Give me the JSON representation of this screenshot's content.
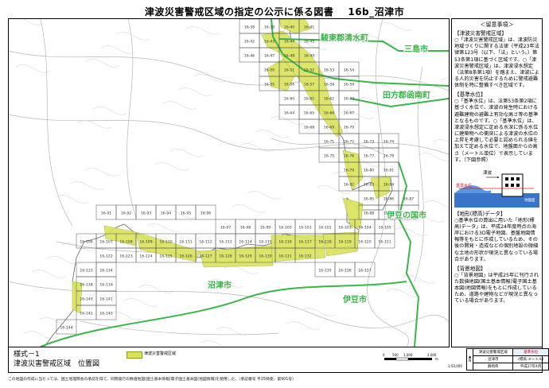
{
  "header": {
    "title": "津波災害警戒区域の指定の公示に係る図書",
    "code": "16b_沼津市"
  },
  "map": {
    "place_labels": [
      {
        "id": "sunto-shimizu",
        "text": "駿東郡清水町"
      },
      {
        "id": "mishima",
        "text": "三島市"
      },
      {
        "id": "tagata-kannami",
        "text": "田方郡函南町"
      },
      {
        "id": "izunokuni",
        "text": "伊豆の国市"
      },
      {
        "id": "numazu",
        "text": "沼津市"
      },
      {
        "id": "izu",
        "text": "伊豆市"
      }
    ],
    "sheets": [
      "16-38",
      "16-39",
      "16-40",
      "16-41",
      "16-42",
      "16-43",
      "16-44",
      "16-45",
      "16-46",
      "16-47",
      "16-48",
      "16-49",
      "16-50",
      "16-51",
      "16-52",
      "16-53",
      "16-54",
      "16-55",
      "16-56",
      "16-57",
      "16-58",
      "16-59",
      "16-60",
      "16-61",
      "16-62",
      "16-63",
      "16-64",
      "16-65",
      "16-66",
      "16-67",
      "16-68",
      "16-69",
      "16-70",
      "16-71",
      "16-72",
      "16-73",
      "16-74",
      "16-75",
      "16-76",
      "16-77",
      "16-78",
      "16-79",
      "16-80",
      "16-81",
      "16-82",
      "16-83",
      "16-84",
      "16-85",
      "16-86",
      "16-87",
      "16-88",
      "16-89",
      "16-90",
      "16-91",
      "16-92",
      "16-93",
      "16-94",
      "16-95",
      "16-96",
      "16-97",
      "16-98",
      "16-99",
      "16-100",
      "16-101",
      "16-102",
      "16-103",
      "16-104",
      "16-105",
      "16-106",
      "16-107",
      "16-108",
      "16-109",
      "16-110",
      "16-111",
      "16-112",
      "16-113",
      "16-114",
      "16-115",
      "16-116",
      "16-117",
      "16-118",
      "16-119",
      "16-120",
      "16-121",
      "16-122",
      "16-123",
      "16-124",
      "16-125",
      "16-126",
      "16-127",
      "16-128",
      "16-129",
      "16-130",
      "16-131",
      "16-132",
      "16-133",
      "16-134",
      "16-135",
      "16-136",
      "16-137",
      "16-138",
      "16-139",
      "16-140",
      "16-141",
      "16-142",
      "16-143",
      "16-144"
    ],
    "colors": {
      "zone": "#d9e35a",
      "zone_edge": "#9aa82a",
      "boundary": "#39b54a",
      "grid": "#555555",
      "road": "#b8b8b8",
      "place_text": "#39b54a"
    }
  },
  "side": {
    "header": "＜留意事項＞",
    "sections": [
      {
        "title": "【津波災害警戒区域】",
        "body": "○「津波災害警戒区域」は、津波防災地域づくりに関する法律（平成23年法律第123号（以下、「法」という。）第53条第1項に基づく区域です。○「津波災害警戒区域」は、津波浸水想定（法第8条第1項）を踏まえ、津波による人的災害を防止するために警戒避難体制を特に整備すべき区域です。"
      },
      {
        "title": "【基準水位】",
        "body": "○「基準水位」は、法第53条第2項に基づく水位で、津波の発生時における避難建物の避難上有効な高さ等の基準となるものです。○「基準水位」は、津波浸水想定に定める水深に係る水位に建築物への衝突による津波の水位の上昇を考慮して必要と認められる値を加えて定める水位で、地盤面からの高さ（メートル単位）で表示しています。（下図参照）"
      },
      {
        "title": "【地形(標高)データ】",
        "body": "○基準水位の算出に用いた「地形(標高)データ」は、平成24年度時点の海岸における3D電子地図、基盤地図情報等をもとに作成しているため、その後の開発・造成などの個別地設の微細な土地の形状が現況と異なっている場合があります。"
      },
      {
        "title": "【背景地図】",
        "body": "○「背景地図」は平成25年に刊行された数値地図(国土基本情報)電子国土基本図(地図情報)をもとに作成しているため、道路や建物などが現況と異なっている場合があります。"
      }
    ],
    "diagram": {
      "tsunami": "津波",
      "base_level": "基準水位",
      "ground_level": "地盤面"
    }
  },
  "bottom": {
    "form": "様式－1",
    "name": "津波災害警戒区域　位置図",
    "legend_label": "津波災害警戒区域",
    "scale_ticks": [
      "0",
      "500",
      "1,000",
      "2,000"
    ],
    "scale_unit": "m",
    "scale_ratio": "1:50,000",
    "table": {
      "r1c1": "津波災害警戒区域",
      "r1c2": "基準水位",
      "r2c1": "沼津市",
      "r2c2": "(標高:メートル)",
      "r3c1": "静岡県",
      "r3c2": "平成27年4月"
    }
  },
  "footnote": "この地図の作成に当たっては、国土地理院長の承認を得て、同院発行の数値地図(国土基本情報)電子国土基本図(地図情報)を使用した。（承認番号 平25情使、第901号）"
}
